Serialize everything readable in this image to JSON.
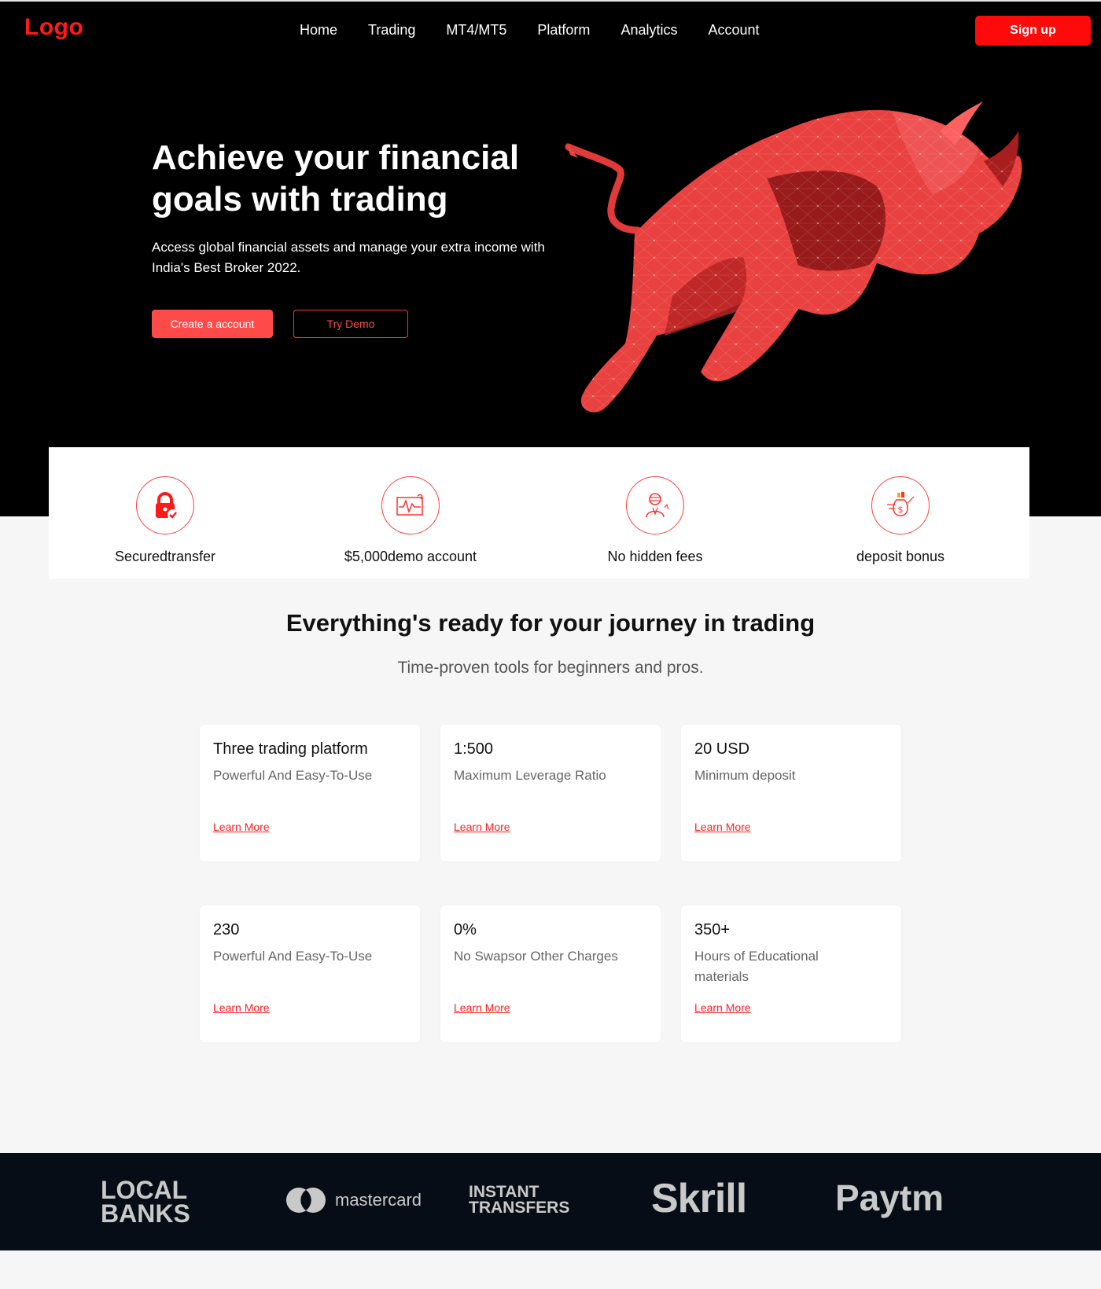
{
  "header": {
    "logo": "Logo",
    "nav": [
      "Home",
      "Trading",
      "MT4/MT5",
      "Platform",
      "Analytics",
      "Account"
    ],
    "signup_label": "Sign up"
  },
  "hero": {
    "title": "Achieve your financial goals with trading",
    "subtitle": "Access global financial assets and manage your extra income with India's Best Broker 2022.",
    "create_label": "Create a account",
    "demo_label": "Try Demo"
  },
  "features": [
    {
      "label": "Securedtransfer",
      "icon": "lock-icon"
    },
    {
      "label": "$5,000demo account",
      "icon": "chart-pulse-icon"
    },
    {
      "label": "No hidden fees",
      "icon": "trader-icon"
    },
    {
      "label": "deposit bonus",
      "icon": "money-bag-icon"
    }
  ],
  "section": {
    "title": "Everything's ready for your journey in trading",
    "subtitle": "Time-proven tools for beginners and pros."
  },
  "cards": [
    {
      "title": "Three trading platform",
      "desc": "Powerful And Easy-To-Use",
      "link": "Learn More"
    },
    {
      "title": "1:500",
      "desc": "Maximum Leverage Ratio",
      "link": "Learn More"
    },
    {
      "title": "20 USD",
      "desc": "Minimum deposit",
      "link": "Learn More"
    },
    {
      "title": "230",
      "desc": "Powerful And Easy-To-Use",
      "link": "Learn More"
    },
    {
      "title": "0%",
      "desc": "No Swapsor Other Charges",
      "link": "Learn More"
    },
    {
      "title": "350+",
      "desc": "Hours of Educational materials",
      "link": "Learn More"
    }
  ],
  "payments": {
    "local_banks_1": "LOCAL",
    "local_banks_2": "BANKS",
    "mastercard": "mastercard",
    "instant_1": "INSTANT",
    "instant_2": "TRANSFERS",
    "skrill": "Skrill",
    "paytm": "Paytm"
  },
  "colors": {
    "accent": "#ff0a0a",
    "hero_bg": "#000000",
    "footer_bg": "#060d16"
  }
}
